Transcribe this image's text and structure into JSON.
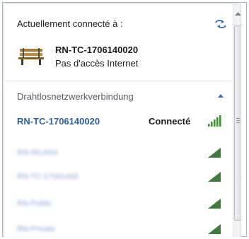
{
  "header": {
    "title": "Actuellement connecté à :",
    "refresh_icon": "refresh-icon"
  },
  "current_connection": {
    "name": "RN-TC-1706140020",
    "status": "Pas d'accès Internet",
    "icon": "bench-network-icon"
  },
  "section": {
    "label": "Drahtlosnetzwerkverbindung",
    "collapse_icon": "chevron-up-icon"
  },
  "networks": [
    {
      "name": "RN-TC-1706140020",
      "state": "Connecté",
      "blurred": false,
      "signal_color": "#3a9a2c"
    },
    {
      "name": "RN-WLAN4",
      "state": "",
      "blurred": true,
      "signal_color": "#3f7b3a"
    },
    {
      "name": "RN-TC-17061400",
      "state": "",
      "blurred": true,
      "signal_color": "#3f7b3a"
    },
    {
      "name": "RN-Public",
      "state": "",
      "blurred": true,
      "signal_color": "#3f7b3a"
    },
    {
      "name": "RN-Private",
      "state": "",
      "blurred": true,
      "signal_color": "#3f7b3a"
    }
  ],
  "colors": {
    "link_blue": "#2e5fa8",
    "signal_green": "#3a9a2c"
  }
}
